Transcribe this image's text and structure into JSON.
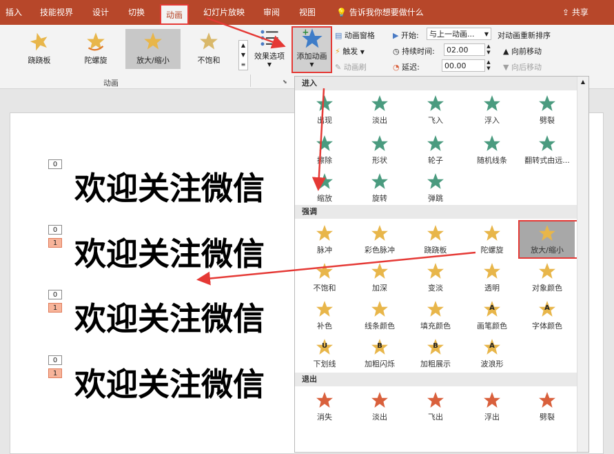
{
  "tabs": [
    "插入",
    "技能视界",
    "设计",
    "切换",
    "动画",
    "幻灯片放映",
    "审阅",
    "视图"
  ],
  "tell_me": "告诉我你想要做什么",
  "share": "共享",
  "gallery": [
    "跷跷板",
    "陀螺旋",
    "放大/缩小",
    "不饱和"
  ],
  "effect_options": "效果选项",
  "add_animation": "添加动画",
  "anim_pane": "动画窗格",
  "trigger": "触发",
  "anim_brush": "动画刷",
  "group_label": "动画",
  "start_label": "开始:",
  "start_value": "与上一动画...",
  "duration_label": "持续时间:",
  "duration_value": "02.00",
  "delay_label": "延迟:",
  "delay_value": "00.00",
  "reorder_title": "对动画重新排序",
  "move_earlier": "向前移动",
  "move_later": "向后移动",
  "slide_text": "欢迎关注微信",
  "tags": {
    "zero": "0",
    "one": "1"
  },
  "panel": {
    "enter_head": "进入",
    "enter_items": [
      "出现",
      "淡出",
      "飞入",
      "浮入",
      "劈裂",
      "擦除",
      "形状",
      "轮子",
      "随机线条",
      "翻转式由远...",
      "缩放",
      "旋转",
      "弹跳"
    ],
    "emph_head": "强调",
    "emph_items": [
      "脉冲",
      "彩色脉冲",
      "跷跷板",
      "陀螺旋",
      "放大/缩小",
      "不饱和",
      "加深",
      "变淡",
      "透明",
      "对象颜色",
      "补色",
      "线条颜色",
      "填充颜色",
      "画笔颜色",
      "字体颜色",
      "下划线",
      "加粗闪烁",
      "加粗展示",
      "波浪形"
    ],
    "exit_head": "退出",
    "exit_items": [
      "消失",
      "淡出",
      "飞出",
      "浮出",
      "劈裂"
    ],
    "letters": {
      "a": "A",
      "u": "U",
      "b": "B"
    }
  },
  "colors": {
    "tabbar": "#b7472a",
    "enter": "#4a9b7f",
    "emph": "#e8b64a",
    "exit": "#d9603c",
    "highlight": "#e53935"
  }
}
